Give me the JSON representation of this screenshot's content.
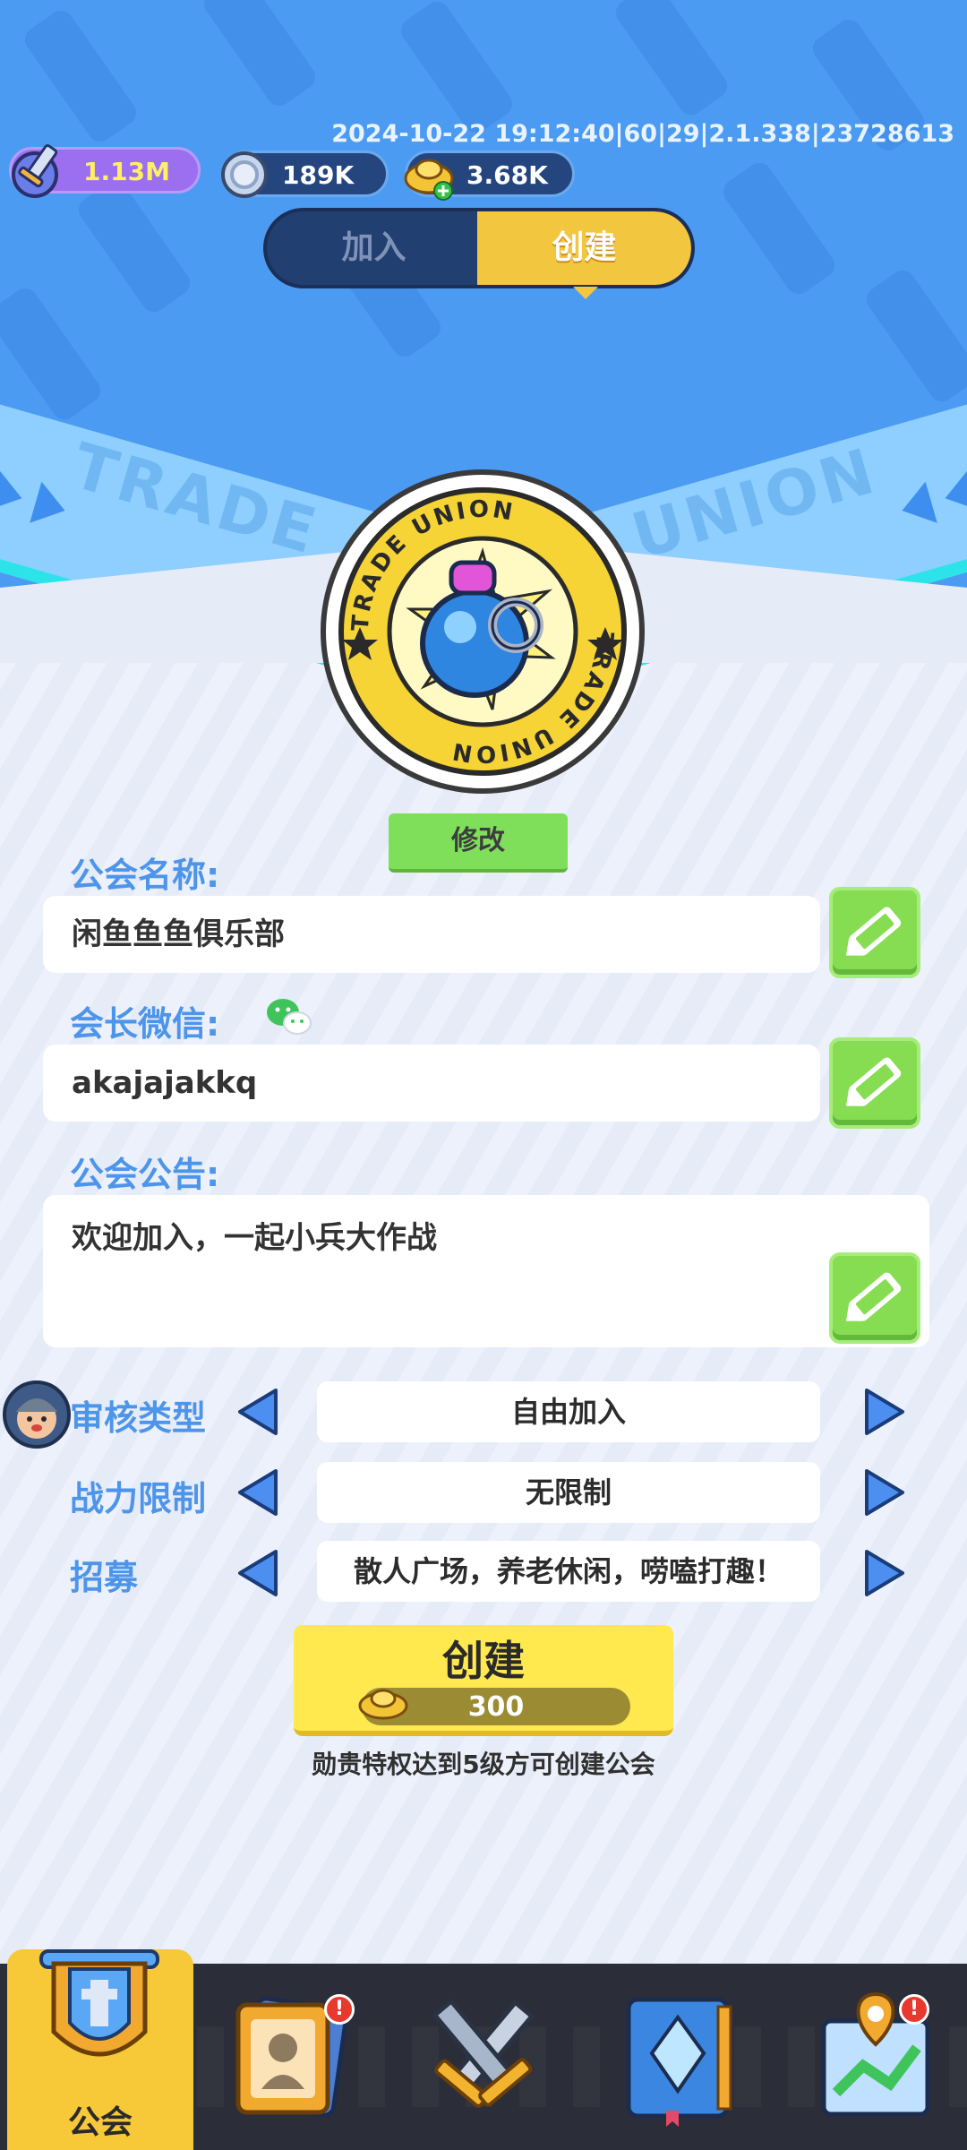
{
  "debug_info": "2024-10-22 19:12:40|60|29|2.1.338|23728613",
  "currencies": {
    "power": "1.13M",
    "coins": "189K",
    "gold": "3.68K"
  },
  "tabs": {
    "join": "加入",
    "create": "创建",
    "active": "create"
  },
  "emblem": {
    "ring_text": "TRADE UNION",
    "edit_label": "修改"
  },
  "banner": {
    "left_text": "TRADE",
    "right_text": "UNION"
  },
  "form": {
    "guild_name_label": "公会名称:",
    "guild_name_value": "闲鱼鱼鱼俱乐部",
    "leader_wechat_label": "会长微信:",
    "leader_wechat_value": "akajajakkq",
    "notice_label": "公会公告:",
    "notice_value": "欢迎加入，一起小兵大作战"
  },
  "options": [
    {
      "label": "审核类型",
      "value": "自由加入"
    },
    {
      "label": "战力限制",
      "value": "无限制"
    },
    {
      "label": "招募",
      "value": "散人广场，养老休闲，唠嗑打趣！"
    }
  ],
  "create_button": {
    "label": "创建",
    "cost": "300"
  },
  "hint": "勋贵特权达到5级方可创建公会",
  "nav": {
    "active_label": "公会",
    "badges": [
      "!",
      "!"
    ]
  },
  "colors": {
    "header_blue": "#4c9bf3",
    "accent_yellow": "#f3c63f",
    "label_blue": "#4d95ea",
    "edit_green": "#86dd52"
  }
}
